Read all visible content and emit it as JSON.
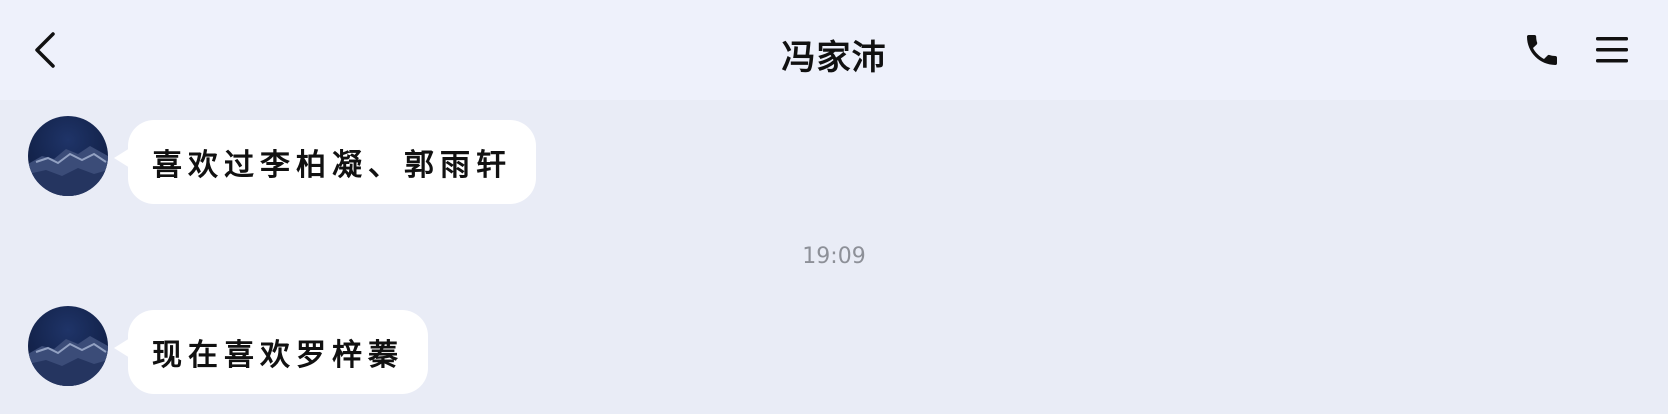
{
  "header": {
    "title": "冯家沛"
  },
  "icons": {
    "back": "chevron-left-icon",
    "call": "phone-icon",
    "menu": "hamburger-menu-icon"
  },
  "messages": [
    {
      "text": "喜欢过李柏凝、郭雨轩"
    },
    {
      "text": "现在喜欢罗梓蓁"
    }
  ],
  "timestamp": "19:09",
  "colors": {
    "background": "#E9ECF6",
    "header": "#EEF1FB",
    "bubble": "#FFFFFF",
    "timestamp": "#8D9098"
  }
}
